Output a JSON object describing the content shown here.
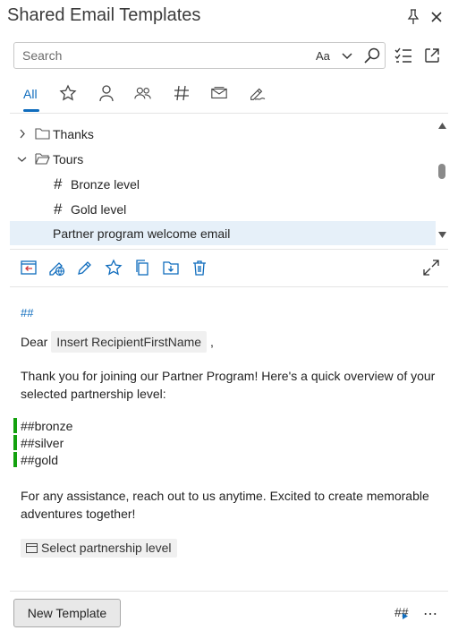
{
  "window": {
    "title": "Shared Email Templates"
  },
  "search": {
    "placeholder": "Search",
    "value": "",
    "match_case_label": "Aa"
  },
  "tabs": {
    "all_label": "All",
    "icons": [
      "star-icon",
      "person-icon",
      "people-icon",
      "hash-icon",
      "mail-macro-icon",
      "signature-icon"
    ]
  },
  "tree": {
    "items": [
      {
        "label": "Thanks",
        "expanded": false,
        "type": "folder"
      },
      {
        "label": "Tours",
        "expanded": true,
        "type": "folder"
      },
      {
        "label": "Bronze level",
        "type": "macro"
      },
      {
        "label": "Gold level",
        "type": "macro"
      },
      {
        "label": "Partner program welcome email",
        "type": "template",
        "selected": true
      }
    ]
  },
  "preview": {
    "top_marker": "##",
    "greeting": "Dear",
    "recipient_chip": "Insert RecipientFirstName",
    "greeting_comma": ",",
    "paragraph1": "Thank you for joining our Partner Program! Here's a quick overview of your selected partnership level:",
    "levels": [
      "##bronze",
      "##silver",
      "##gold"
    ],
    "paragraph2": "For any assistance, reach out to us anytime. Excited to create memorable adventures together!",
    "select_chip": "Select partnership level"
  },
  "footer": {
    "new_template_label": "New Template",
    "hash_label": "##",
    "more_label": "⋯"
  },
  "colors": {
    "accent": "#0f6cbd",
    "selected_row": "#e6f0f9",
    "level_bar": "#13a10e"
  }
}
